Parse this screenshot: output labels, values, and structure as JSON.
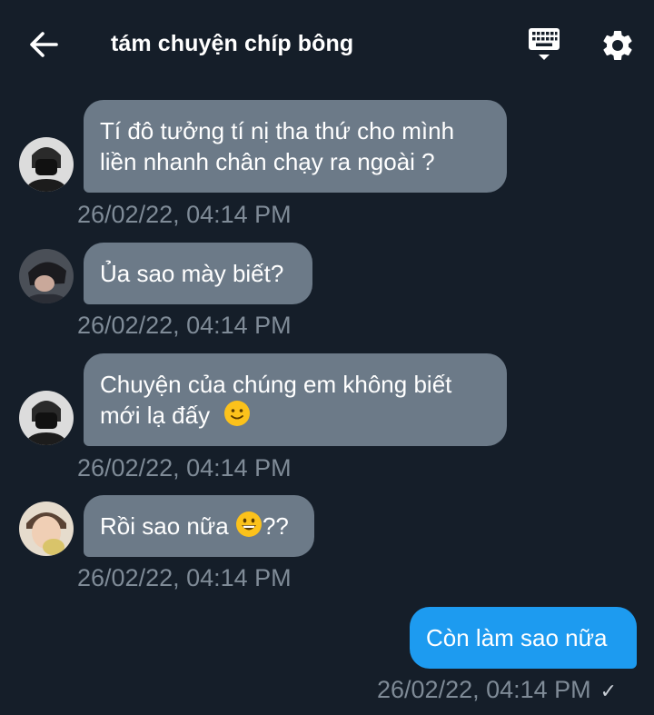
{
  "header": {
    "title": "tám chuyện chíp bông",
    "back_icon": "arrow-left-icon",
    "keyboard_icon": "keyboard-icon",
    "settings_icon": "gear-icon"
  },
  "colors": {
    "background": "#151e29",
    "incoming_bubble": "#6c7a88",
    "outgoing_bubble": "#1d9bf0",
    "timestamp": "#7f8b97"
  },
  "messages": [
    {
      "direction": "incoming",
      "line1": "Tí đô tưởng tí nị tha thứ cho mình",
      "line2": "liền nhanh chân chạy ra ngoài ?",
      "time": "26/02/22, 04:14 PM"
    },
    {
      "direction": "incoming",
      "line1": "Ủa sao mày biết?",
      "time": "26/02/22, 04:14 PM"
    },
    {
      "direction": "incoming",
      "line1": "Chuyện của chúng em không biết",
      "line2": "mới lạ đấy",
      "emoji": "slightly-smiling-face-emoji",
      "time": "26/02/22, 04:14 PM"
    },
    {
      "direction": "incoming",
      "text_before": "Rồi sao nữa ",
      "emoji": "grinning-face-emoji",
      "text_after": "??",
      "time": "26/02/22, 04:14 PM"
    },
    {
      "direction": "outgoing",
      "line1": "Còn làm sao nữa",
      "time": "26/02/22, 04:14 PM",
      "status_icon": "checkmark-icon",
      "status_glyph": "✓"
    }
  ]
}
